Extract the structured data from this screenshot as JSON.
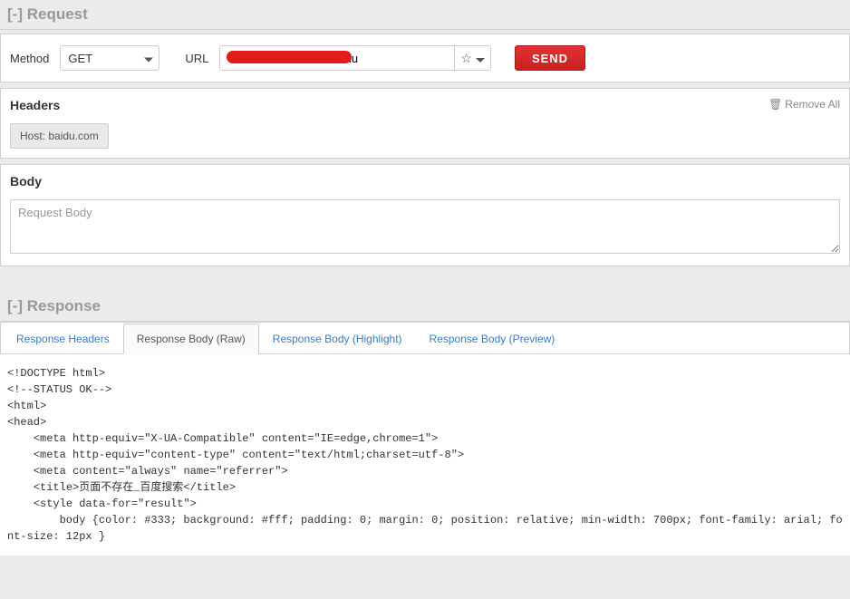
{
  "request": {
    "title": "Request",
    "toggle": "[-]",
    "method_label": "Method",
    "method_value": "GET",
    "url_label": "URL",
    "url_value": "                              /baidu",
    "send_label": "SEND"
  },
  "headers": {
    "title": "Headers",
    "remove_all": "Remove All",
    "items": [
      {
        "text": "Host: baidu.com"
      }
    ]
  },
  "body": {
    "title": "Body",
    "placeholder": "Request Body",
    "value": ""
  },
  "response": {
    "title": "Response",
    "toggle": "[-]",
    "tabs": [
      {
        "label": "Response Headers",
        "active": false
      },
      {
        "label": "Response Body (Raw)",
        "active": true
      },
      {
        "label": "Response Body (Highlight)",
        "active": false
      },
      {
        "label": "Response Body (Preview)",
        "active": false
      }
    ],
    "raw_body": "<!DOCTYPE html>\n<!--STATUS OK-->\n<html>\n<head>\n    <meta http-equiv=\"X-UA-Compatible\" content=\"IE=edge,chrome=1\">\n    <meta http-equiv=\"content-type\" content=\"text/html;charset=utf-8\">\n    <meta content=\"always\" name=\"referrer\">\n    <title>页面不存在_百度搜索</title>\n    <style data-for=\"result\">\n        body {color: #333; background: #fff; padding: 0; margin: 0; position: relative; min-width: 700px; font-family: arial; font-size: 12px }"
  }
}
